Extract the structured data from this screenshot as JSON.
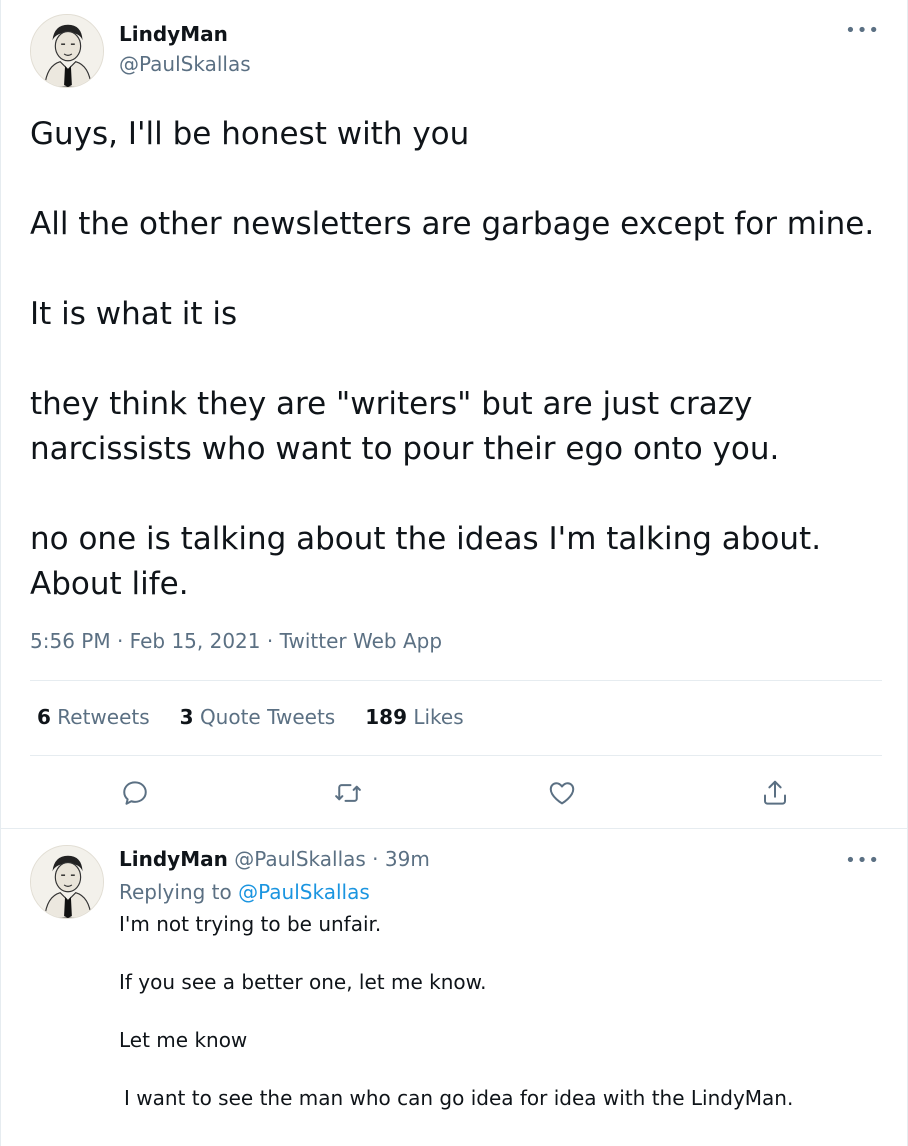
{
  "tweet": {
    "author_name": "LindyMan",
    "author_handle": "@PaulSkallas",
    "more_label": "•••",
    "paragraphs": [
      "Guys, I'll be honest with you",
      "All the other newsletters are garbage except for mine.",
      "It is what it is",
      "they think they are \"writers\" but are just crazy narcissists who want to pour their ego onto you.",
      "no one is talking about the ideas I'm talking about. About life."
    ],
    "time": "5:56 PM",
    "date": "Feb 15, 2021",
    "source": "Twitter Web App",
    "meta_separator": "·"
  },
  "stats": {
    "retweets_count": "6",
    "retweets_label": "Retweets",
    "quotes_count": "3",
    "quotes_label": "Quote Tweets",
    "likes_count": "189",
    "likes_label": "Likes"
  },
  "actions": {
    "icons": [
      "reply-icon",
      "retweet-icon",
      "like-icon",
      "share-icon"
    ]
  },
  "reply": {
    "author_name": "LindyMan",
    "author_handle": "@PaulSkallas",
    "separator": "·",
    "time_ago": "39m",
    "more_label": "•••",
    "replying_prefix": "Replying to",
    "replying_to": "@PaulSkallas",
    "lines": [
      "I'm not trying to be unfair.",
      "If you see a better one, let me know.",
      "Let me know",
      "I want to see the man who can go idea for idea with the LindyMan."
    ]
  },
  "colors": {
    "text": "#0f1419",
    "muted": "#5b7083",
    "link": "#1b95e0",
    "divider": "#e6ecf0"
  }
}
